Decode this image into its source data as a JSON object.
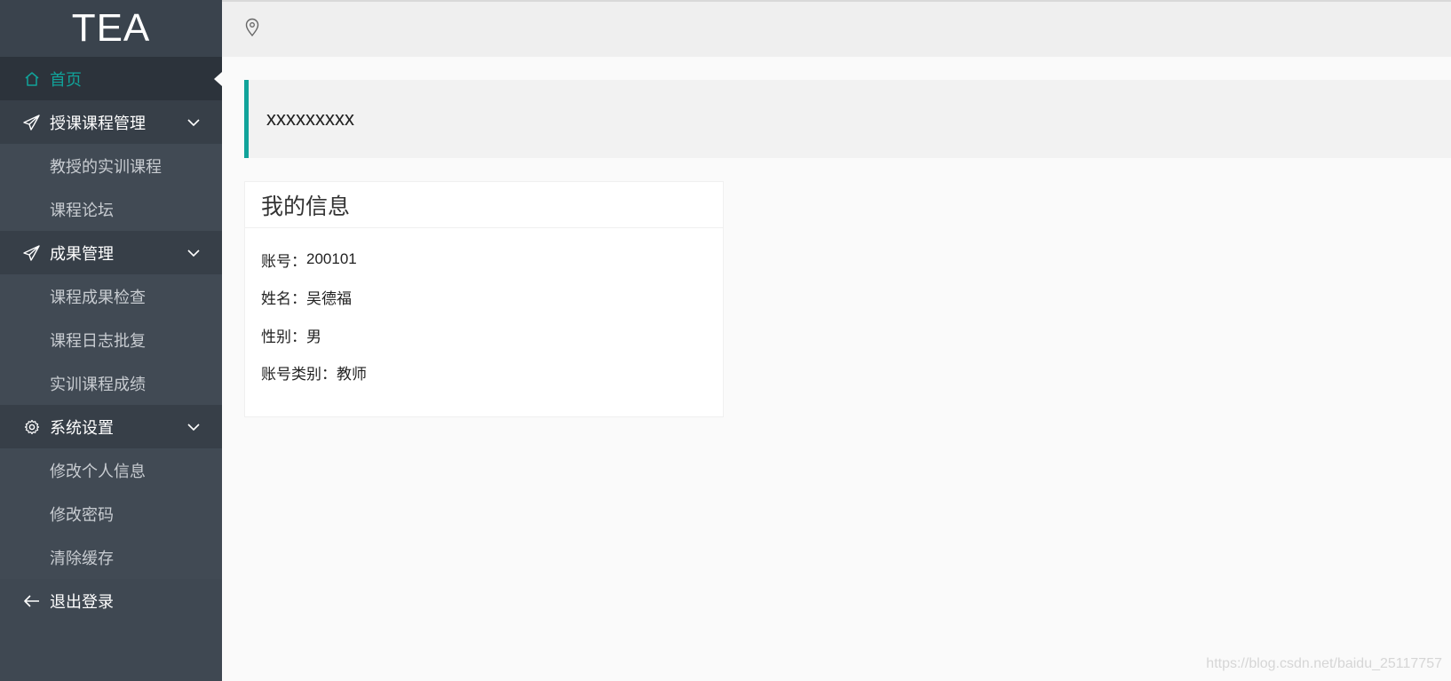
{
  "app": {
    "logo": "TEA"
  },
  "sidebar": {
    "active_color": "#11a39a",
    "items": [
      {
        "label": "首页",
        "icon": "home-icon",
        "active": true
      },
      {
        "label": "授课课程管理",
        "icon": "paper-plane-icon",
        "expanded": true,
        "children": [
          "教授的实训课程",
          "课程论坛"
        ]
      },
      {
        "label": "成果管理",
        "icon": "paper-plane-icon",
        "expanded": true,
        "children": [
          "课程成果检查",
          "课程日志批复",
          "实训课程成绩"
        ]
      },
      {
        "label": "系统设置",
        "icon": "gear-icon",
        "expanded": true,
        "children": [
          "修改个人信息",
          "修改密码",
          "清除缓存"
        ]
      },
      {
        "label": "退出登录",
        "icon": "arrow-left-icon"
      }
    ]
  },
  "topbar": {
    "icon": "location-pin-icon"
  },
  "banner": {
    "text": "xxxxxxxxx"
  },
  "info_card": {
    "title": "我的信息",
    "rows": [
      {
        "label": "账号：",
        "value": "200101"
      },
      {
        "label": "姓名：",
        "value": "吴德福"
      },
      {
        "label": "性别：",
        "value": "男"
      },
      {
        "label": "账号类别：",
        "value": "教师"
      }
    ]
  },
  "watermark": "https://blog.csdn.net/baidu_25117757"
}
